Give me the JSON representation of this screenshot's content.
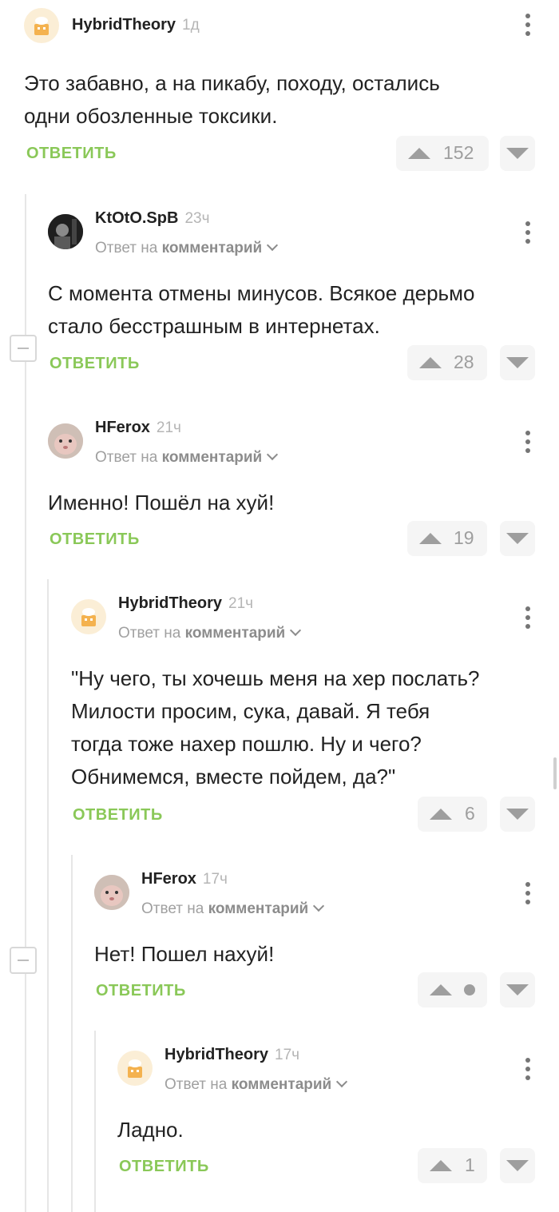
{
  "reply_label": "ОТВЕТИТЬ",
  "reply_to_prefix": "Ответ на",
  "reply_to_target": "комментарий",
  "comments": [
    {
      "author": "HybridTheory",
      "time": "1д",
      "reply_to": false,
      "text_lines": [
        "Это забавно, а на пикабу, походу, остались",
        "одни обозленные токсики."
      ],
      "score": "152"
    },
    {
      "author": "KtOtO.SpB",
      "time": "23ч",
      "reply_to": true,
      "text_lines": [
        "С момента отмены минусов. Всякое дерьмо",
        "стало бесстрашным в интернетах."
      ],
      "score": "28"
    },
    {
      "author": "HFerox",
      "time": "21ч",
      "reply_to": true,
      "text_lines": [
        "Именно! Пошёл на хуй!"
      ],
      "score": "19"
    },
    {
      "author": "HybridTheory",
      "time": "21ч",
      "reply_to": true,
      "text_lines": [
        "\"Ну чего, ты хочешь меня на хер послать?",
        "Милости просим, сука, давай. Я тебя",
        "тогда тоже нахер пошлю. Ну и чего?",
        "Обнимемся, вместе пойдем, да?\""
      ],
      "score": "6"
    },
    {
      "author": "HFerox",
      "time": "17ч",
      "reply_to": true,
      "text_lines": [
        "Нет! Пошел нахуй!"
      ],
      "score": ""
    },
    {
      "author": "HybridTheory",
      "time": "17ч",
      "reply_to": true,
      "text_lines": [
        "Ладно."
      ],
      "score": "1"
    }
  ],
  "colors": {
    "accent": "#8ac858",
    "muted": "#9e9e9e"
  }
}
